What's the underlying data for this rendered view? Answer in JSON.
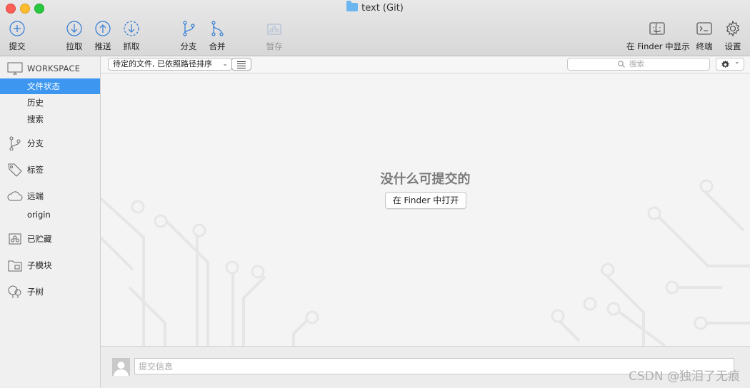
{
  "window": {
    "title": "text (Git)"
  },
  "toolbar": {
    "commit": "提交",
    "pull": "拉取",
    "push": "推送",
    "fetch": "抓取",
    "branch": "分支",
    "merge": "合并",
    "stash": "暂存",
    "show_in_finder": "在 Finder 中显示",
    "terminal": "终端",
    "settings": "设置"
  },
  "sidebar": {
    "workspace": "WORKSPACE",
    "workspace_items": [
      "文件状态",
      "历史",
      "搜索"
    ],
    "selected": "文件状态",
    "branches": "分支",
    "tags": "标签",
    "remotes": "远端",
    "remote_items": [
      "origin"
    ],
    "stashes": "已贮藏",
    "submodules": "子模块",
    "subtrees": "子树"
  },
  "filterbar": {
    "sort_option": "待定的文件, 已依照路径排序",
    "search_placeholder": "搜索"
  },
  "main": {
    "empty_message": "没什么可提交的",
    "open_in_finder": "在 Finder 中打开"
  },
  "commit": {
    "placeholder": "提交信息"
  },
  "watermark": "CSDN @独泪了无痕",
  "colors": {
    "selection": "#3d97f0",
    "icon_blue": "#2f7bd6"
  }
}
